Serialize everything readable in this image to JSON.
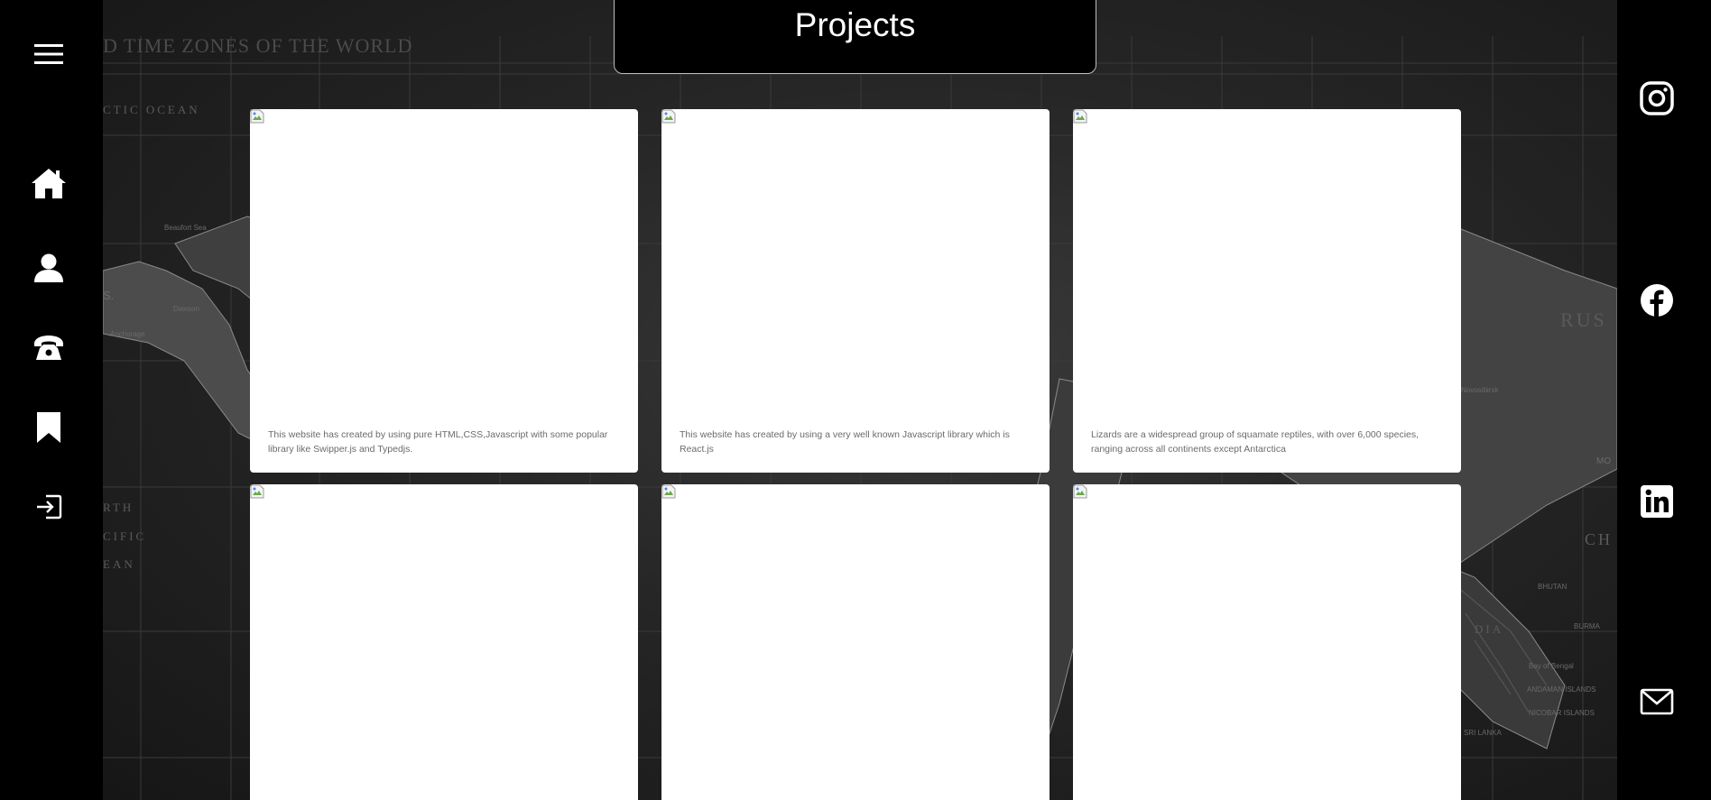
{
  "header": {
    "title": "Projects"
  },
  "nav": {
    "menu_icon": "hamburger-icon",
    "items": [
      {
        "name": "home",
        "icon": "home-icon"
      },
      {
        "name": "about",
        "icon": "user-icon"
      },
      {
        "name": "contact",
        "icon": "phone-icon"
      },
      {
        "name": "projects",
        "icon": "bookmark-icon"
      },
      {
        "name": "login",
        "icon": "sign-in-icon"
      }
    ]
  },
  "social": {
    "items": [
      {
        "name": "instagram",
        "icon": "instagram-icon"
      },
      {
        "name": "facebook",
        "icon": "facebook-icon"
      },
      {
        "name": "linkedin",
        "icon": "linkedin-icon"
      },
      {
        "name": "email",
        "icon": "mail-icon"
      }
    ]
  },
  "background_map": {
    "title": "D TIME ZONES OF THE WORLD",
    "labels": [
      "CTIC OCEAN",
      "RTH",
      "CIFIC",
      "EAN",
      "RUS",
      "CH",
      "DIA"
    ],
    "small_labels": [
      "Beaufort Sea",
      "Dawson",
      "Anchorage",
      "S.",
      "MO",
      "SRI LANKA",
      "BURMA",
      "NICOBAR ISLANDS",
      "ANDAMAN ISLANDS",
      "Bay of Bengal",
      "Novosibirsk",
      "BHUTAN"
    ]
  },
  "projects": {
    "cards": [
      {
        "description": "This website has created by using pure HTML,CSS,Javascript with some popular library like Swipper.js and Typedjs."
      },
      {
        "description": "This website has created by using a very well known Javascript library which is React.js"
      },
      {
        "description": "Lizards are a widespread group of squamate reptiles, with over 6,000 species, ranging across all continents except Antarctica"
      },
      {
        "description": ""
      },
      {
        "description": ""
      },
      {
        "description": ""
      }
    ]
  },
  "colors": {
    "background": "#000000",
    "card": "#ffffff",
    "card_text": "#6b6b6b",
    "header_border": "#bdbdbd"
  }
}
